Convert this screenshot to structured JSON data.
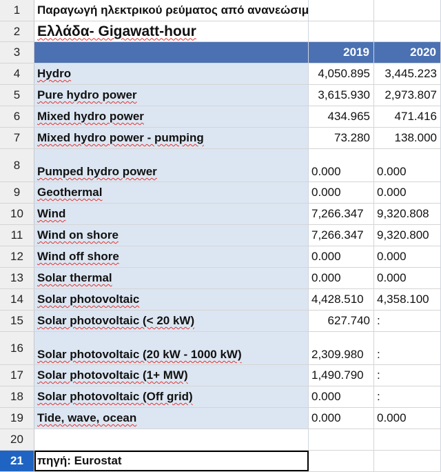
{
  "title_row": "Παραγωγή ηλεκτρικού ρεύματος από ανανεώσιμες πηγές",
  "subtitle_row": "Ελλάδα- Gigawatt-hour",
  "year1": "2019",
  "year2": "2020",
  "row_numbers": [
    "1",
    "2",
    "3",
    "4",
    "5",
    "6",
    "7",
    "8",
    "9",
    "10",
    "11",
    "12",
    "13",
    "14",
    "15",
    "16",
    "17",
    "18",
    "19",
    "20",
    "21"
  ],
  "rows": [
    {
      "label": "Hydro",
      "v2019": "4,050.895",
      "v2020": "3,445.223"
    },
    {
      "label": "Pure hydro power",
      "v2019": "3,615.930",
      "v2020": "2,973.807"
    },
    {
      "label": "Mixed hydro power",
      "v2019": "434.965",
      "v2020": "471.416"
    },
    {
      "label": "Mixed hydro power - pumping",
      "v2019": "73.280",
      "v2020": "138.000"
    },
    {
      "label": "Pumped hydro power",
      "v2019": "0.000",
      "v2020": "0.000"
    },
    {
      "label": "Geothermal",
      "v2019": "0.000",
      "v2020": "0.000"
    },
    {
      "label": "Wind",
      "v2019": "7,266.347",
      "v2020": "9,320.808"
    },
    {
      "label": "Wind on shore",
      "v2019": "7,266.347",
      "v2020": "9,320.800"
    },
    {
      "label": "Wind off shore",
      "v2019": "0.000",
      "v2020": "0.000"
    },
    {
      "label": "Solar thermal",
      "v2019": "0.000",
      "v2020": "0.000"
    },
    {
      "label": "Solar photovoltaic",
      "v2019": "4,428.510",
      "v2020": "4,358.100"
    },
    {
      "label": "Solar photovoltaic (< 20 kW)",
      "v2019": "627.740",
      "v2020": ":"
    },
    {
      "label": "Solar photovoltaic (20 kW - 1000 kW)",
      "v2019": "2,309.980",
      "v2020": ":"
    },
    {
      "label": "Solar photovoltaic (1+ MW)",
      "v2019": "1,490.790",
      "v2020": ":"
    },
    {
      "label": "Solar photovoltaic (Off grid)",
      "v2019": "0.000",
      "v2020": ":"
    },
    {
      "label": "Tide, wave, ocean",
      "v2019": "0.000",
      "v2020": "0.000"
    }
  ],
  "source": "πηγή: Eurostat"
}
